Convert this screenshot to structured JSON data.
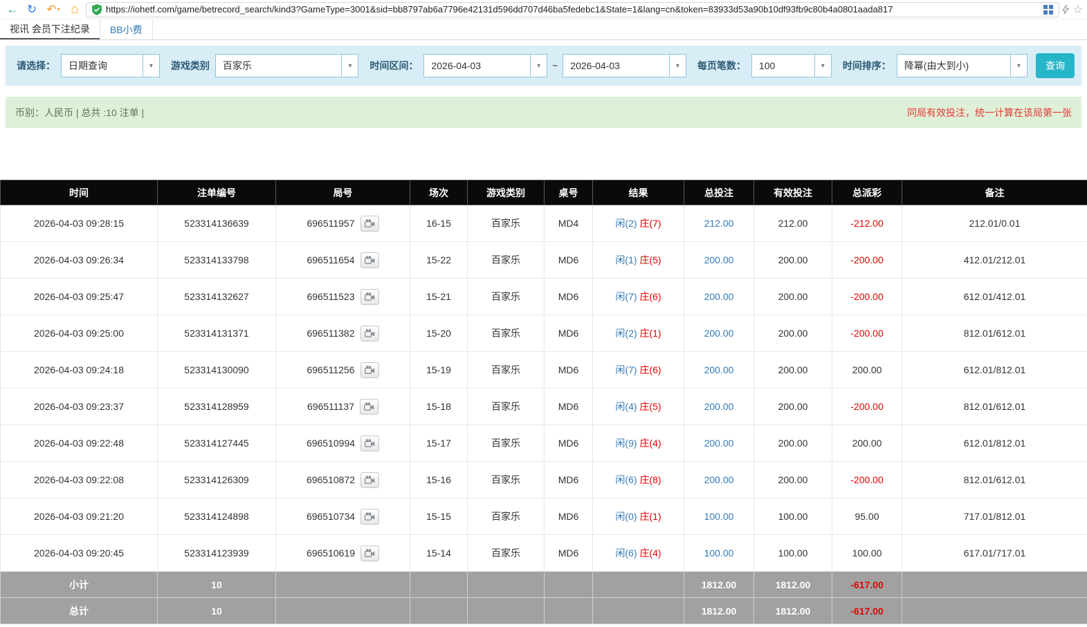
{
  "browser": {
    "url": "https://iohetf.com/game/betrecord_search/kind3?GameType=3001&sid=bb8797ab6a7796e42131d596dd707d46ba5fedebc1&State=1&lang=cn&token=83933d53a90b10df93fb9c80b4a0801aada817"
  },
  "glyphs": {
    "back": "←",
    "refresh": "↻",
    "undo": "↶",
    "caret_small": "▾",
    "home": "⌂",
    "star": "☆",
    "caret": "▾"
  },
  "tabs": {
    "breadcrumb": "视讯 会员下注纪录",
    "bb_tab": "BB小费"
  },
  "filters": {
    "select_label": "请选择：",
    "query_type": "日期查询",
    "game_type_label": "游戏类别",
    "game_type": "百家乐",
    "time_range_label": "时间区间：",
    "date_from": "2026-04-03",
    "range_separator": "~",
    "date_to": "2026-04-03",
    "page_size_label": "每页笔数：",
    "page_size": "100",
    "sort_label": "时间排序：",
    "sort_order": "降幂(由大到小)",
    "search_button": "查询"
  },
  "summary": {
    "left": "币别：人民币 | 总共 :10 注单 |",
    "right": "同局有效投注，统一计算在该局第一张"
  },
  "table": {
    "headers": [
      "时间",
      "注单编号",
      "局号",
      "场次",
      "游戏类别",
      "桌号",
      "结果",
      "总投注",
      "有效投注",
      "总派彩",
      "备注"
    ],
    "rows": [
      {
        "time": "2026-04-03 09:28:15",
        "bet_id": "523314136639",
        "round_id": "696511957",
        "session": "16-15",
        "game": "百家乐",
        "table_no": "MD4",
        "result_player": "闲(2)",
        "result_banker": "庄(7)",
        "total_bet": "212.00",
        "valid_bet": "212.00",
        "payout": "-212.00",
        "remark": "212.01/0.01"
      },
      {
        "time": "2026-04-03 09:26:34",
        "bet_id": "523314133798",
        "round_id": "696511654",
        "session": "15-22",
        "game": "百家乐",
        "table_no": "MD6",
        "result_player": "闲(1)",
        "result_banker": "庄(5)",
        "total_bet": "200.00",
        "valid_bet": "200.00",
        "payout": "-200.00",
        "remark": "412.01/212.01"
      },
      {
        "time": "2026-04-03 09:25:47",
        "bet_id": "523314132627",
        "round_id": "696511523",
        "session": "15-21",
        "game": "百家乐",
        "table_no": "MD6",
        "result_player": "闲(7)",
        "result_banker": "庄(6)",
        "total_bet": "200.00",
        "valid_bet": "200.00",
        "payout": "-200.00",
        "remark": "612.01/412.01"
      },
      {
        "time": "2026-04-03 09:25:00",
        "bet_id": "523314131371",
        "round_id": "696511382",
        "session": "15-20",
        "game": "百家乐",
        "table_no": "MD6",
        "result_player": "闲(2)",
        "result_banker": "庄(1)",
        "total_bet": "200.00",
        "valid_bet": "200.00",
        "payout": "-200.00",
        "remark": "812.01/612.01"
      },
      {
        "time": "2026-04-03 09:24:18",
        "bet_id": "523314130090",
        "round_id": "696511256",
        "session": "15-19",
        "game": "百家乐",
        "table_no": "MD6",
        "result_player": "闲(7)",
        "result_banker": "庄(6)",
        "total_bet": "200.00",
        "valid_bet": "200.00",
        "payout": "200.00",
        "remark": "612.01/812.01"
      },
      {
        "time": "2026-04-03 09:23:37",
        "bet_id": "523314128959",
        "round_id": "696511137",
        "session": "15-18",
        "game": "百家乐",
        "table_no": "MD6",
        "result_player": "闲(4)",
        "result_banker": "庄(5)",
        "total_bet": "200.00",
        "valid_bet": "200.00",
        "payout": "-200.00",
        "remark": "812.01/612.01"
      },
      {
        "time": "2026-04-03 09:22:48",
        "bet_id": "523314127445",
        "round_id": "696510994",
        "session": "15-17",
        "game": "百家乐",
        "table_no": "MD6",
        "result_player": "闲(9)",
        "result_banker": "庄(4)",
        "total_bet": "200.00",
        "valid_bet": "200.00",
        "payout": "200.00",
        "remark": "612.01/812.01"
      },
      {
        "time": "2026-04-03 09:22:08",
        "bet_id": "523314126309",
        "round_id": "696510872",
        "session": "15-16",
        "game": "百家乐",
        "table_no": "MD6",
        "result_player": "闲(6)",
        "result_banker": "庄(8)",
        "total_bet": "200.00",
        "valid_bet": "200.00",
        "payout": "-200.00",
        "remark": "812.01/612.01"
      },
      {
        "time": "2026-04-03 09:21:20",
        "bet_id": "523314124898",
        "round_id": "696510734",
        "session": "15-15",
        "game": "百家乐",
        "table_no": "MD6",
        "result_player": "闲(0)",
        "result_banker": "庄(1)",
        "total_bet": "100.00",
        "valid_bet": "100.00",
        "payout": "95.00",
        "remark": "717.01/812.01"
      },
      {
        "time": "2026-04-03 09:20:45",
        "bet_id": "523314123939",
        "round_id": "696510619",
        "session": "15-14",
        "game": "百家乐",
        "table_no": "MD6",
        "result_player": "闲(6)",
        "result_banker": "庄(4)",
        "total_bet": "100.00",
        "valid_bet": "100.00",
        "payout": "100.00",
        "remark": "617.01/717.01"
      }
    ],
    "footer": [
      {
        "label": "小计",
        "count": "10",
        "total_bet": "1812.00",
        "valid_bet": "1812.00",
        "payout": "-617.00"
      },
      {
        "label": "总计",
        "count": "10",
        "total_bet": "1812.00",
        "valid_bet": "1812.00",
        "payout": "-617.00"
      }
    ]
  }
}
